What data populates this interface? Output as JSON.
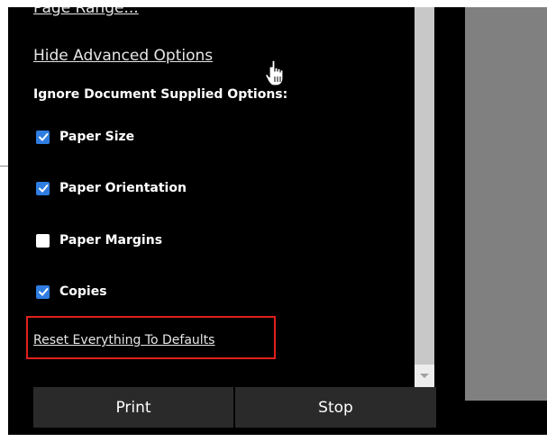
{
  "links": {
    "page_range": "Page Range...",
    "hide_advanced": "Hide Advanced Options",
    "reset_defaults": "Reset Everything To Defaults"
  },
  "ignore_label": "Ignore Document Supplied Options:",
  "options": [
    {
      "label": "Paper Size",
      "checked": true
    },
    {
      "label": "Paper Orientation",
      "checked": true
    },
    {
      "label": "Paper Margins",
      "checked": false
    },
    {
      "label": "Copies",
      "checked": true
    }
  ],
  "buttons": {
    "print": "Print",
    "stop": "Stop"
  },
  "colors": {
    "panel_bg": "#000000",
    "checkbox_checked": "#2f7de1",
    "highlight_border": "#e0201b",
    "button_bg": "#2a2a2a",
    "preview_gray": "#808080"
  },
  "icons": {
    "checkbox_checked": "check-icon",
    "cursor": "hand-pointer-icon",
    "scroll_down": "arrow-down-icon"
  }
}
